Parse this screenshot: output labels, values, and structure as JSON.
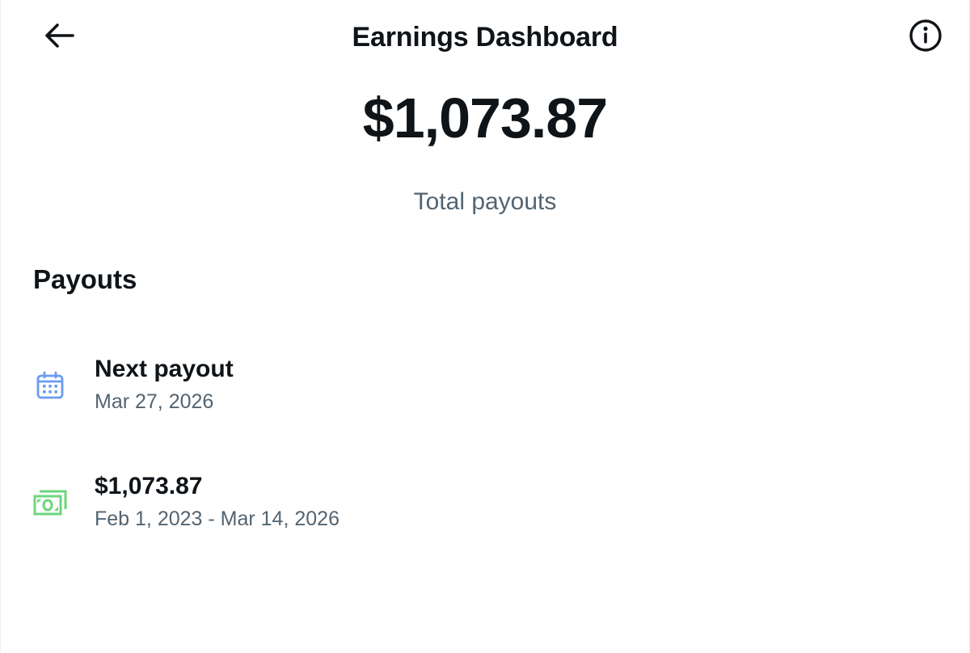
{
  "header": {
    "title": "Earnings Dashboard",
    "back_icon": "arrow-left-icon",
    "info_icon": "info-circle-icon"
  },
  "summary": {
    "total_amount": "$1,073.87",
    "total_label": "Total payouts"
  },
  "payouts": {
    "heading": "Payouts",
    "items": [
      {
        "icon": "calendar-icon",
        "icon_color": "#6b9bf0",
        "title": "Next payout",
        "subtitle": "Mar 27, 2026"
      },
      {
        "icon": "money-icon",
        "icon_color": "#6cd67c",
        "title": "$1,073.87",
        "subtitle": "Feb 1, 2023 - Mar 14, 2026"
      }
    ]
  },
  "colors": {
    "text_primary": "#0f1419",
    "text_secondary": "#536471"
  }
}
